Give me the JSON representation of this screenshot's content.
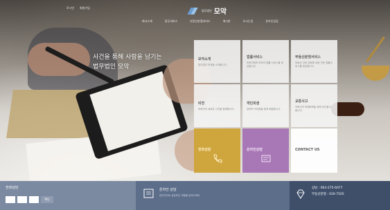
{
  "header": {
    "util_links": [
      "로그인",
      "회원가입"
    ],
    "logo_small": "법무법인",
    "logo_big": "모악",
    "nav_items": [
      "회사소개",
      "업무서비스",
      "부동산분쟁서비스",
      "게시판",
      "오시는길",
      "온라인상담"
    ]
  },
  "hero": {
    "tagline_line1": "사건을 통해 사람을 남기는",
    "tagline_line2": "법무법인 모악"
  },
  "tiles": [
    {
      "title": "모악소개",
      "desc": "법무법인 모악을 소개합니다.",
      "color": "light"
    },
    {
      "title": "법률서비스",
      "desc": "의뢰인에게 최적의 법률 서비스를 제공합니다.",
      "color": "light"
    },
    {
      "title": "부동산분쟁서비스",
      "desc": "부동산 관련 분쟁에 대한 전문 법률서비스를 제공합니다.",
      "color": "light"
    },
    {
      "title": "비전",
      "desc": "의뢰인의 새로운 시작을 함께합니다.",
      "color": "light"
    },
    {
      "title": "개인회생",
      "desc": "경제적 어려움을 함께 해결합니다.",
      "color": "light"
    },
    {
      "title": "교통사고",
      "desc": "의뢰인의 피해회복을 위해 최선을 다합니다.",
      "color": "light"
    },
    {
      "title": "전화상담",
      "desc": "",
      "color": "yellow",
      "icon": "phone-icon"
    },
    {
      "title": "온라인상담",
      "desc": "",
      "color": "purple",
      "icon": "chat-form-icon"
    },
    {
      "title": "CONTACT US",
      "desc": "",
      "color": "white"
    }
  ],
  "bottom": {
    "quick_title": "전화상담",
    "quick_button": "확인",
    "online_title": "온라인 상담",
    "online_desc": "온라인으로 궁금하신 사항을 남겨주세요.",
    "phone_line1": "상담 : 063-275-6077",
    "phone_line2": "부동산분쟁 : 010-7505"
  },
  "colors": {
    "yellow_tile": "#cfa53d",
    "purple_tile": "#a877b5",
    "bottom_left": "#7b8aa1",
    "bottom_mid": "#5d6e8a",
    "bottom_right": "#3f4f6a"
  }
}
